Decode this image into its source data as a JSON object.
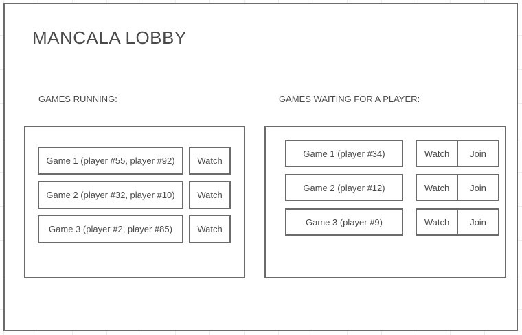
{
  "lobby": {
    "title": "MANCALA LOBBY"
  },
  "running": {
    "label": "GAMES RUNNING:",
    "games": [
      {
        "name": "Game 1 (player #55, player #92)",
        "watch_label": "Watch"
      },
      {
        "name": "Game 2 (player #32, player #10)",
        "watch_label": "Watch"
      },
      {
        "name": "Game 3 (player #2, player #85)",
        "watch_label": "Watch"
      }
    ]
  },
  "waiting": {
    "label": "GAMES WAITING FOR A PLAYER:",
    "games": [
      {
        "name": "Game 1 (player #34)",
        "watch_label": "Watch",
        "join_label": "Join"
      },
      {
        "name": "Game 2 (player #12)",
        "watch_label": "Watch",
        "join_label": "Join"
      },
      {
        "name": "Game 3 (player #9)",
        "watch_label": "Watch",
        "join_label": "Join"
      }
    ]
  }
}
